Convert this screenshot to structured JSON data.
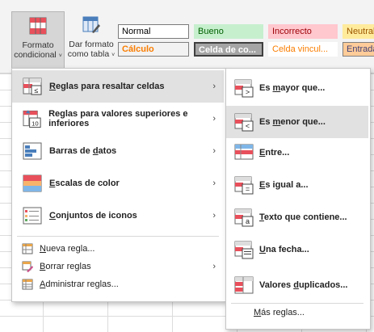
{
  "ribbon": {
    "format_button": {
      "line1": "Formato",
      "line2": "condicional",
      "caret": "˅"
    },
    "table_button": {
      "line1": "Dar formato",
      "line2": "como tabla",
      "caret": "˅"
    },
    "styles": [
      {
        "label": "Normal",
        "bg": "#ffffff",
        "fg": "#000000",
        "border": "#7a7a7a"
      },
      {
        "label": "Bueno",
        "bg": "#c6efce",
        "fg": "#006100",
        "border": "#c6efce"
      },
      {
        "label": "Incorrecto",
        "bg": "#ffc7ce",
        "fg": "#9c0006",
        "border": "#ffc7ce"
      },
      {
        "label": "Neutral",
        "bg": "#ffeb9c",
        "fg": "#9c5700",
        "border": "#ffeb9c"
      },
      {
        "label": "Cálculo",
        "bg": "#f2f2f2",
        "fg": "#fa7d00",
        "border": "#7f7f7f"
      },
      {
        "label": "Celda de co...",
        "bg": "#a5a5a5",
        "fg": "#ffffff",
        "border": "#3f3f3f"
      },
      {
        "label": "Celda vincul...",
        "bg": "#ffffff",
        "fg": "#fa7d00",
        "border": "#ffffff"
      },
      {
        "label": "Entrada",
        "bg": "#ffcc99",
        "fg": "#3f3f76",
        "border": "#7f7f7f"
      }
    ]
  },
  "menu": {
    "items": [
      {
        "pre": "",
        "mnemonic": "R",
        "post": "eglas para resaltar celdas",
        "icon": "highlight-rules-icon",
        "submenu": true,
        "highlighted": true
      },
      {
        "pre": "Reglas para valores superiores e inferiores",
        "mnemonic": "",
        "post": "",
        "icon": "top-bottom-rules-icon",
        "submenu": true,
        "highlighted": false
      },
      {
        "pre": "Barras de ",
        "mnemonic": "d",
        "post": "atos",
        "icon": "data-bars-icon",
        "submenu": true,
        "highlighted": false
      },
      {
        "pre": "",
        "mnemonic": "E",
        "post": "scalas de color",
        "icon": "color-scales-icon",
        "submenu": true,
        "highlighted": false
      },
      {
        "pre": "",
        "mnemonic": "C",
        "post": "onjuntos de iconos",
        "icon": "icon-sets-icon",
        "submenu": true,
        "highlighted": false
      }
    ],
    "small_items": [
      {
        "pre": "",
        "mnemonic": "N",
        "post": "ueva regla...",
        "icon": "new-rule-icon",
        "submenu": false
      },
      {
        "pre": "",
        "mnemonic": "B",
        "post": "orrar reglas",
        "icon": "clear-rules-icon",
        "submenu": true
      },
      {
        "pre": "",
        "mnemonic": "A",
        "post": "dministrar reglas...",
        "icon": "manage-rules-icon",
        "submenu": false
      }
    ],
    "arrow": "›"
  },
  "submenu": {
    "items": [
      {
        "pre": "Es ",
        "mnemonic": "m",
        "post": "ayor que...",
        "icon": "greater-than-icon",
        "highlighted": false
      },
      {
        "pre": "Es ",
        "mnemonic": "m",
        "post": "enor que...",
        "icon": "less-than-icon",
        "highlighted": true
      },
      {
        "pre": "",
        "mnemonic": "E",
        "post": "ntre...",
        "icon": "between-icon",
        "highlighted": false
      },
      {
        "pre": "",
        "mnemonic": "E",
        "post": "s igual a...",
        "icon": "equal-to-icon",
        "highlighted": false
      },
      {
        "pre": "",
        "mnemonic": "T",
        "post": "exto que contiene...",
        "icon": "text-contains-icon",
        "highlighted": false
      },
      {
        "pre": "",
        "mnemonic": "U",
        "post": "na fecha...",
        "icon": "date-occurring-icon",
        "highlighted": false
      },
      {
        "pre": "Valores ",
        "mnemonic": "d",
        "post": "uplicados...",
        "icon": "duplicate-values-icon",
        "highlighted": false
      }
    ],
    "more": {
      "pre": "",
      "mnemonic": "M",
      "post": "ás reglas..."
    }
  }
}
